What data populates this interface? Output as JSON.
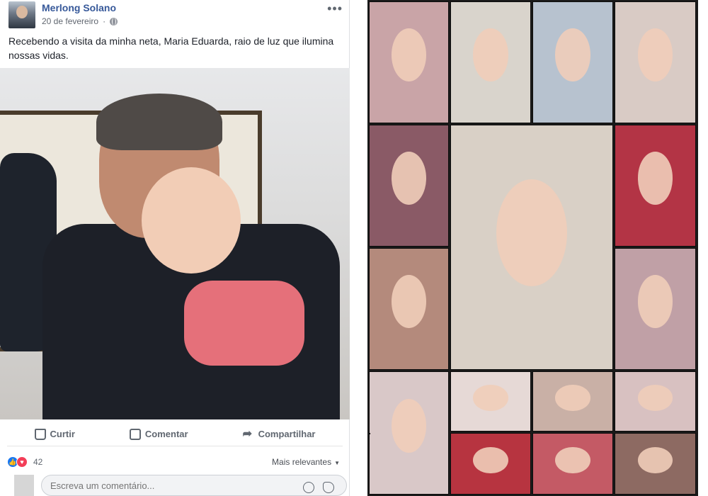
{
  "post": {
    "author": "Merlong Solano",
    "date": "20 de fevereiro",
    "more_label": "•••",
    "text": "Recebendo a visita da minha neta, Maria Eduarda, raio de luz que ilumina nossas vidas.",
    "actions": {
      "like": "Curtir",
      "comment": "Comentar",
      "share": "Compartilhar"
    },
    "reactions": {
      "count": "42",
      "sort_label": "Mais relevantes"
    },
    "comment_placeholder": "Escreva um comentário..."
  },
  "collage": {
    "tiles": [
      {
        "color": "#c9a4a7"
      },
      {
        "color": "#d9d4cc"
      },
      {
        "color": "#b7c2cf"
      },
      {
        "color": "#d9cbc5"
      },
      {
        "color": "#8a5a66"
      },
      {
        "color": "#d9d0c6"
      },
      {
        "color": "#b33445"
      },
      {
        "color": "#b48a7c"
      },
      {
        "color": "#c0a0a6"
      },
      {
        "color": "#d9c8c8"
      },
      {
        "color": "#e6d9d6"
      },
      {
        "color": "#c9b0a6"
      },
      {
        "color": "#d8c1c1"
      },
      {
        "color": "#b73440"
      },
      {
        "color": "#c45a65"
      },
      {
        "color": "#8d6a62"
      },
      {
        "color": "#cfc2c6"
      }
    ]
  }
}
